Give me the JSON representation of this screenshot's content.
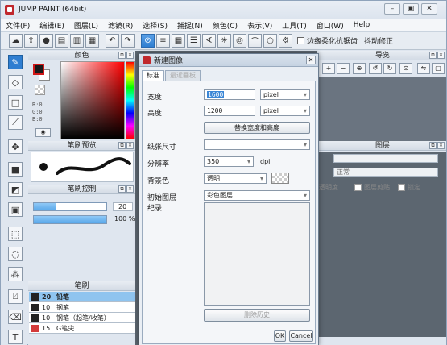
{
  "window": {
    "title": "JUMP PAINT (64bit)",
    "controls": [
      "–",
      "▣",
      "✕"
    ]
  },
  "menu": [
    "文件(F)",
    "编辑(E)",
    "图层(L)",
    "滤镜(R)",
    "选择(S)",
    "捕捉(N)",
    "颜色(C)",
    "表示(V)",
    "工具(T)",
    "窗口(W)",
    "Help"
  ],
  "toolbar": {
    "antialias_label": "边缘柔化抗锯齿",
    "stabilizer_label": "抖动修正"
  },
  "color_panel": {
    "title": "颜色",
    "r": "R:0",
    "g": "G:0",
    "b": "B:0",
    "fg": "#1a1a1a",
    "bg": "#ffffff"
  },
  "brush_preview": {
    "title": "笔刷预览"
  },
  "brush_control": {
    "title": "笔刷控制",
    "size_value": "20",
    "opacity_value": "100 %",
    "size_fraction": 0.3,
    "opacity_fraction": 1.0
  },
  "brush_list": {
    "title": "笔刷",
    "items": [
      {
        "num": "20",
        "name": "铅笔",
        "color": "#222222",
        "selected": true
      },
      {
        "num": "10",
        "name": "钢笔",
        "color": "#222222",
        "selected": false
      },
      {
        "num": "10",
        "name": "钢笔（起笔/收笔）",
        "color": "#222222",
        "selected": false
      },
      {
        "num": "15",
        "name": "G笔尖",
        "color": "#d33a3a",
        "selected": false
      }
    ]
  },
  "navigator": {
    "title": "导览"
  },
  "layers": {
    "title": "图层",
    "blend_mode": "正常",
    "opacity_label": "透明度",
    "clip_label": "图层剪贴",
    "lock_label": "锁定"
  },
  "dialog": {
    "title": "新建图像",
    "tab_standard": "标准",
    "tab_history": "最近画板",
    "width_label": "宽度",
    "width_value": "1600",
    "width_unit": "pixel",
    "height_label": "高度",
    "height_value": "1200",
    "height_unit": "pixel",
    "swap_button": "替换宽度和高度",
    "paper_label": "纸张尺寸",
    "paper_value": "",
    "resolution_label": "分辨率",
    "resolution_value": "350",
    "resolution_unit": "dpi",
    "bgcolor_label": "背景色",
    "bgcolor_value": "透明",
    "initial_layer_label": "初始图层",
    "initial_layer_value": "彩色图层",
    "memo_label": "纪录",
    "delete_history_button": "删除历史",
    "ok_button": "OK",
    "cancel_button": "Cancel"
  }
}
